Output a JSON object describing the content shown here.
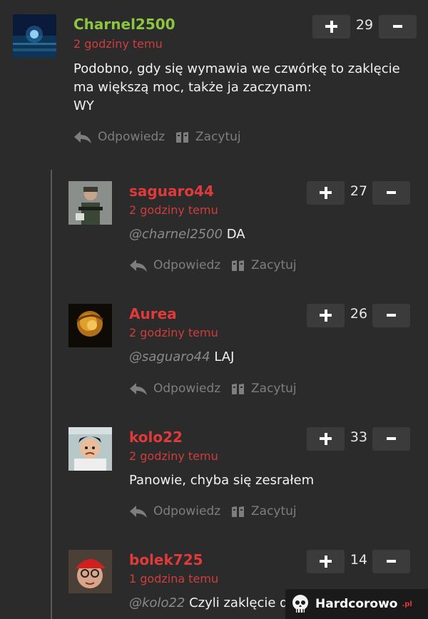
{
  "comments": [
    {
      "username": "Charnel2500",
      "time": "2 godziny temu",
      "lines": [
        "Podobno, gdy się wymawia we czwórkę to zaklęcie",
        "ma większą moc, także ja zaczynam:",
        "WY"
      ],
      "score": "29",
      "reply_label": "Odpowiedz",
      "quote_label": "Zacytuj"
    },
    {
      "username": "saguaro44",
      "time": "2 godziny temu",
      "mention": "@charnel2500",
      "text": "DA",
      "score": "27",
      "reply_label": "Odpowiedz",
      "quote_label": "Zacytuj"
    },
    {
      "username": "Aurea",
      "time": "2 godziny temu",
      "mention": "@saguaro44",
      "text": "LAJ",
      "score": "26",
      "reply_label": "Odpowiedz",
      "quote_label": "Zacytuj"
    },
    {
      "username": "kolo22",
      "time": "2 godziny temu",
      "text": "Panowie, chyba się zesrałem",
      "score": "33",
      "reply_label": "Odpowiedz",
      "quote_label": "Zacytuj"
    },
    {
      "username": "bolek725",
      "time": "1 godzina temu",
      "mention": "@kolo22",
      "text": "Czyli zaklęcie d",
      "score": "14"
    }
  ],
  "watermark": {
    "brand": "Hardcorowo",
    "tld": ".pl"
  },
  "colors": {
    "background": "#2b2b2b",
    "username_green": "#8cc63f",
    "username_red": "#e03a3a",
    "timestamp": "#d13c3c",
    "button": "#3b3b3b"
  }
}
